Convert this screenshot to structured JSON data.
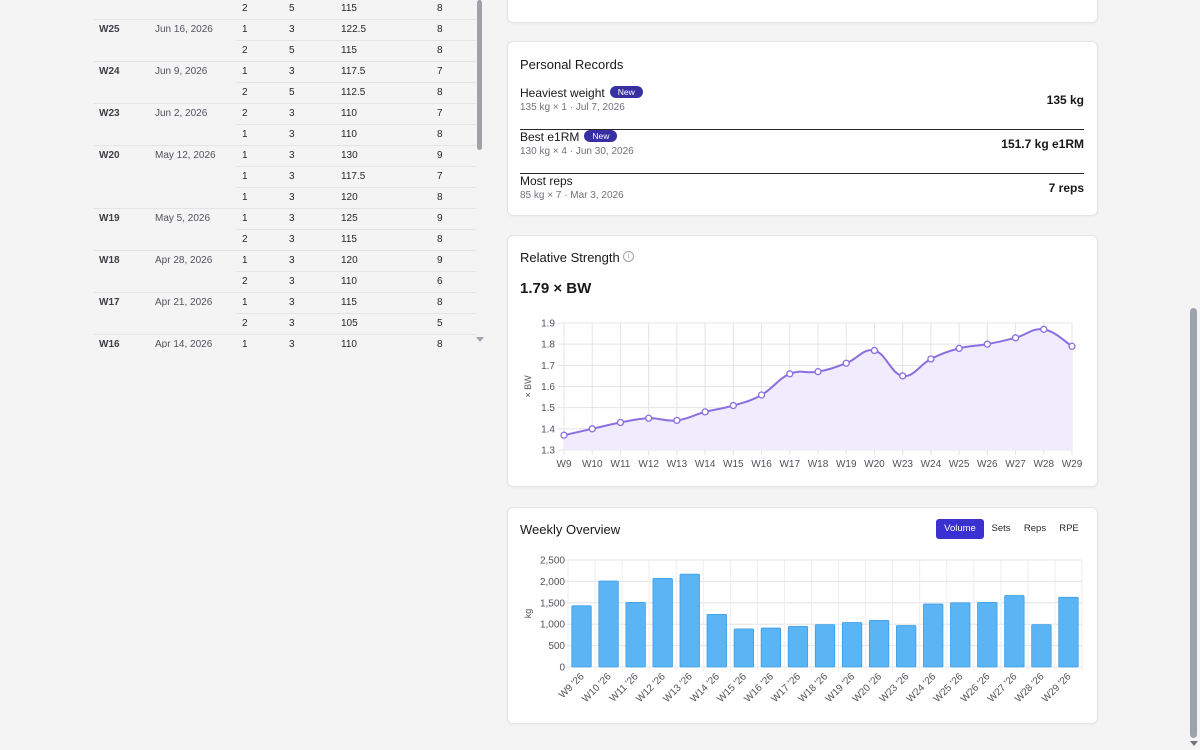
{
  "log": {
    "rows": [
      {
        "week": "",
        "date": "",
        "set": "2",
        "reps": "5",
        "weight": "115",
        "rpe": "8"
      },
      {
        "week": "W25",
        "date": "Jun 16, 2026",
        "set": "1",
        "reps": "3",
        "weight": "122.5",
        "rpe": "8"
      },
      {
        "week": "",
        "date": "",
        "set": "2",
        "reps": "5",
        "weight": "115",
        "rpe": "8"
      },
      {
        "week": "W24",
        "date": "Jun 9, 2026",
        "set": "1",
        "reps": "3",
        "weight": "117.5",
        "rpe": "7"
      },
      {
        "week": "",
        "date": "",
        "set": "2",
        "reps": "5",
        "weight": "112.5",
        "rpe": "8"
      },
      {
        "week": "W23",
        "date": "Jun 2, 2026",
        "set": "2",
        "reps": "3",
        "weight": "110",
        "rpe": "7"
      },
      {
        "week": "",
        "date": "",
        "set": "1",
        "reps": "3",
        "weight": "110",
        "rpe": "8"
      },
      {
        "week": "W20",
        "date": "May 12, 2026",
        "set": "1",
        "reps": "3",
        "weight": "130",
        "rpe": "9"
      },
      {
        "week": "",
        "date": "",
        "set": "1",
        "reps": "3",
        "weight": "117.5",
        "rpe": "7"
      },
      {
        "week": "",
        "date": "",
        "set": "1",
        "reps": "3",
        "weight": "120",
        "rpe": "8"
      },
      {
        "week": "W19",
        "date": "May 5, 2026",
        "set": "1",
        "reps": "3",
        "weight": "125",
        "rpe": "9"
      },
      {
        "week": "",
        "date": "",
        "set": "2",
        "reps": "3",
        "weight": "115",
        "rpe": "8"
      },
      {
        "week": "W18",
        "date": "Apr 28, 2026",
        "set": "1",
        "reps": "3",
        "weight": "120",
        "rpe": "9"
      },
      {
        "week": "",
        "date": "",
        "set": "2",
        "reps": "3",
        "weight": "110",
        "rpe": "6"
      },
      {
        "week": "W17",
        "date": "Apr 21, 2026",
        "set": "1",
        "reps": "3",
        "weight": "115",
        "rpe": "8"
      },
      {
        "week": "",
        "date": "",
        "set": "2",
        "reps": "3",
        "weight": "105",
        "rpe": "5"
      },
      {
        "week": "W16",
        "date": "Apr 14, 2026",
        "set": "1",
        "reps": "3",
        "weight": "110",
        "rpe": "8"
      }
    ]
  },
  "top_axis": {
    "labels": [
      "W9",
      "W10",
      "W11",
      "W12",
      "W13",
      "W14",
      "W15",
      "W16",
      "W17",
      "W18",
      "W19",
      "W20",
      "W23",
      "W24",
      "W25",
      "W26",
      "W27",
      "W28",
      "W29"
    ]
  },
  "personal_records": {
    "title": "Personal Records",
    "items": [
      {
        "name": "Heaviest weight",
        "badge": "New",
        "sub": "135 kg × 1 · Jul 7, 2026",
        "value": "135 kg"
      },
      {
        "name": "Best e1RM",
        "badge": "New",
        "sub": "130 kg × 4 · Jun 30, 2026",
        "value": "151.7 kg e1RM"
      },
      {
        "name": "Most reps",
        "badge": "",
        "sub": "85 kg × 7 · Mar 3, 2026",
        "value": "7 reps"
      }
    ]
  },
  "relative_strength": {
    "title": "Relative Strength",
    "info_icon": "info-icon",
    "current": "1.79 × BW"
  },
  "weekly_overview": {
    "title": "Weekly Overview",
    "tabs": [
      {
        "label": "Volume",
        "active": true
      },
      {
        "label": "Sets",
        "active": false
      },
      {
        "label": "Reps",
        "active": false
      },
      {
        "label": "RPE",
        "active": false
      }
    ]
  },
  "colors": {
    "line": "#8b6ee0",
    "area": "#f1ecfd",
    "bar": "#5bb5f5",
    "bar_stroke": "#3a9de6",
    "accent": "#3b30d0"
  },
  "chart_data": [
    {
      "type": "line",
      "title": "",
      "x": [
        "W9",
        "W10",
        "W11",
        "W12",
        "W13",
        "W14",
        "W15",
        "W16",
        "W17",
        "W18",
        "W19",
        "W20",
        "W23",
        "W24",
        "W25",
        "W26",
        "W27",
        "W28",
        "W29"
      ],
      "series": [
        {
          "values": [
            1.37,
            1.4,
            1.43,
            1.45,
            1.44,
            1.48,
            1.51,
            1.56,
            1.66,
            1.67,
            1.71,
            1.77,
            1.65,
            1.73,
            1.78,
            1.8,
            1.83,
            1.87,
            1.79
          ]
        }
      ],
      "xlabel": "",
      "ylabel": "× BW",
      "yticks": [
        "1.3",
        "1.4",
        "1.5",
        "1.6",
        "1.7",
        "1.8",
        "1.9"
      ],
      "ylim": [
        1.3,
        1.9
      ],
      "grid": true
    },
    {
      "type": "bar",
      "title": "",
      "categories": [
        "W9 '26",
        "W10 '26",
        "W11 '26",
        "W12 '26",
        "W13 '26",
        "W14 '26",
        "W15 '26",
        "W16 '26",
        "W17 '26",
        "W18 '26",
        "W19 '26",
        "W20 '26",
        "W23 '26",
        "W24 '26",
        "W25 '26",
        "W26 '26",
        "W27 '26",
        "W28 '26",
        "W29 '26"
      ],
      "values": [
        1430,
        2010,
        1510,
        2070,
        2170,
        1230,
        890,
        910,
        950,
        990,
        1040,
        1090,
        970,
        1470,
        1500,
        1510,
        1670,
        990,
        1630
      ],
      "xlabel": "",
      "ylabel": "kg",
      "yticks": [
        "0",
        "500",
        "1,000",
        "1,500",
        "2,000",
        "2,500"
      ],
      "ylim": [
        0,
        2500
      ],
      "grid": true
    }
  ]
}
